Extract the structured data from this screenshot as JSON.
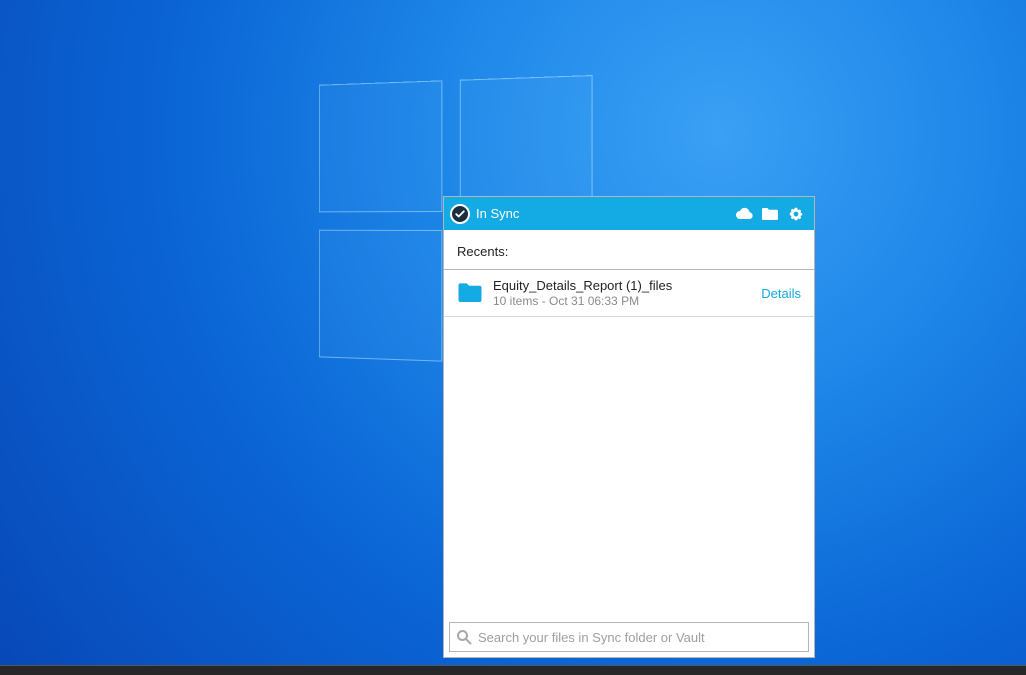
{
  "panel": {
    "status_label": "In Sync",
    "recents_label": "Recents:",
    "items": [
      {
        "name": "Equity_Details_Report (1)_files",
        "meta": "10 items - Oct 31 06:33 PM",
        "details_label": "Details"
      }
    ],
    "search": {
      "placeholder": "Search your files in Sync folder or Vault"
    }
  }
}
